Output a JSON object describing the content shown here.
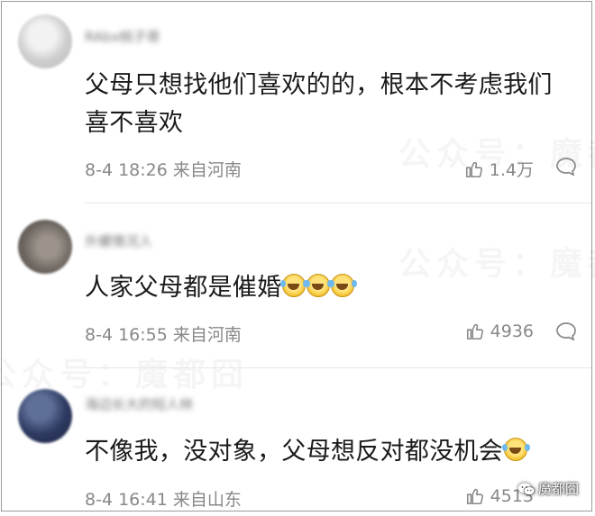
{
  "comments": [
    {
      "username": "RAbx桃子哥",
      "text": "父母只想找他们喜欢的的，根本不考虑我们喜不喜欢",
      "emojis": [],
      "time": "8-4 18:26",
      "location": "来自河南",
      "likes": "1.4万"
    },
    {
      "username": "外螺情况人",
      "text": "人家父母都是催婚",
      "emojis": [
        "laughing-crying-emoji",
        "laughing-crying-emoji",
        "laughing-crying-emoji"
      ],
      "time": "8-4 16:55",
      "location": "来自河南",
      "likes": "4936"
    },
    {
      "username": "海边长大的短人林",
      "text": "不像我，没对象，父母想反对都没机会",
      "emojis": [
        "laughing-crying-emoji"
      ],
      "time": "8-4 16:41",
      "location": "来自山东",
      "likes": "4513"
    }
  ],
  "watermark_text": "公众号：魔都囧",
  "brand_label": "魔都囧",
  "icons": [
    "thumbs-up-icon",
    "reply-bubble-icon",
    "wechat-icon"
  ],
  "colors": {
    "text": "#1a1a1a",
    "meta": "#888888",
    "emoji": "#f4c430"
  }
}
